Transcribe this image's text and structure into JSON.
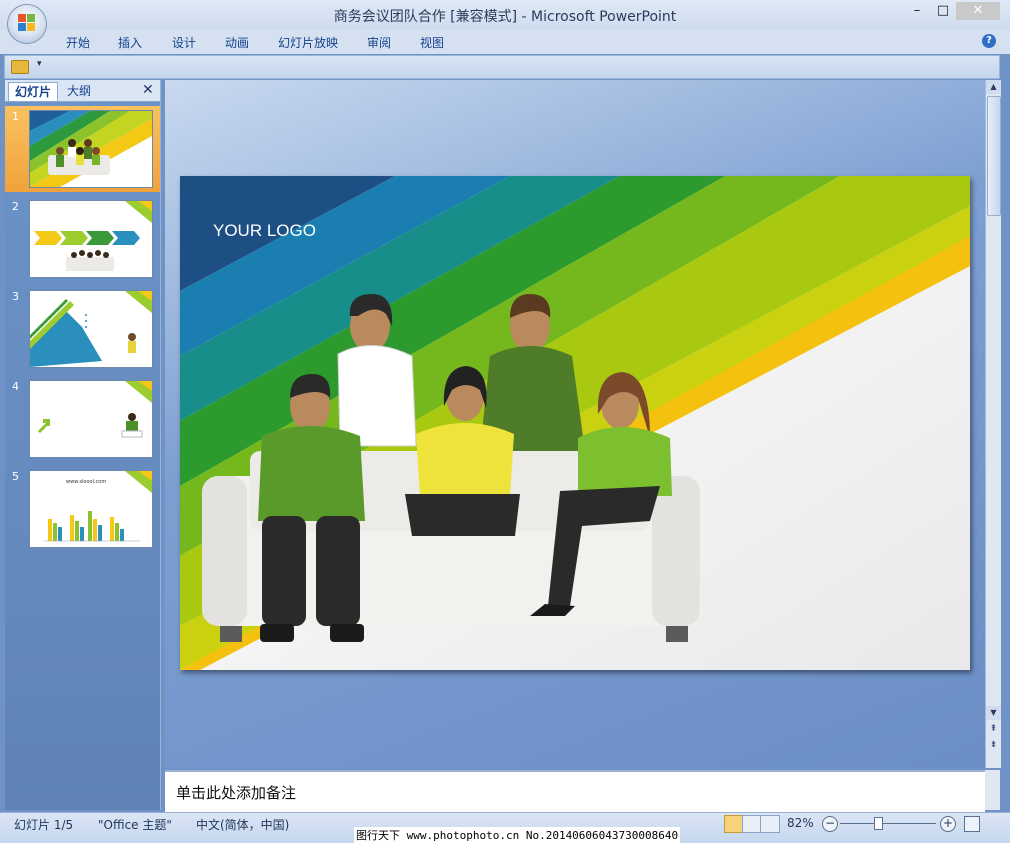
{
  "window": {
    "title": "商务会议团队合作 [兼容模式] - Microsoft PowerPoint",
    "minimize": "–",
    "maximize": "□",
    "close": "✕"
  },
  "ribbon": {
    "tabs": [
      "开始",
      "插入",
      "设计",
      "动画",
      "幻灯片放映",
      "审阅",
      "视图"
    ],
    "help_icon": "?"
  },
  "quick_access": {
    "open_icon": "folder-open-icon",
    "customize": "▾"
  },
  "slide_pane": {
    "tabs": {
      "slides": "幻灯片",
      "outline": "大纲"
    },
    "close": "✕",
    "thumbnails": [
      {
        "number": "1",
        "selected": true
      },
      {
        "number": "2",
        "selected": false
      },
      {
        "number": "3",
        "selected": false
      },
      {
        "number": "4",
        "selected": false
      },
      {
        "number": "5",
        "selected": false
      }
    ],
    "thumb5_caption": "www.sloool.com"
  },
  "slide": {
    "logo_text": "YOUR LOGO"
  },
  "notes": {
    "placeholder": "单击此处添加备注"
  },
  "statusbar": {
    "slide_indicator": "幻灯片 1/5",
    "theme": "\"Office 主题\"",
    "language": "中文(简体，中国)",
    "watermark": "图行天下 www.photophoto.cn  No.20140606043730008640",
    "zoom_percent": "82%",
    "zoom_out": "−",
    "zoom_in": "+"
  },
  "colors": {
    "accent": "#15428b",
    "selected_thumb": "#f0a23c",
    "workspace": "#6f93c7"
  }
}
